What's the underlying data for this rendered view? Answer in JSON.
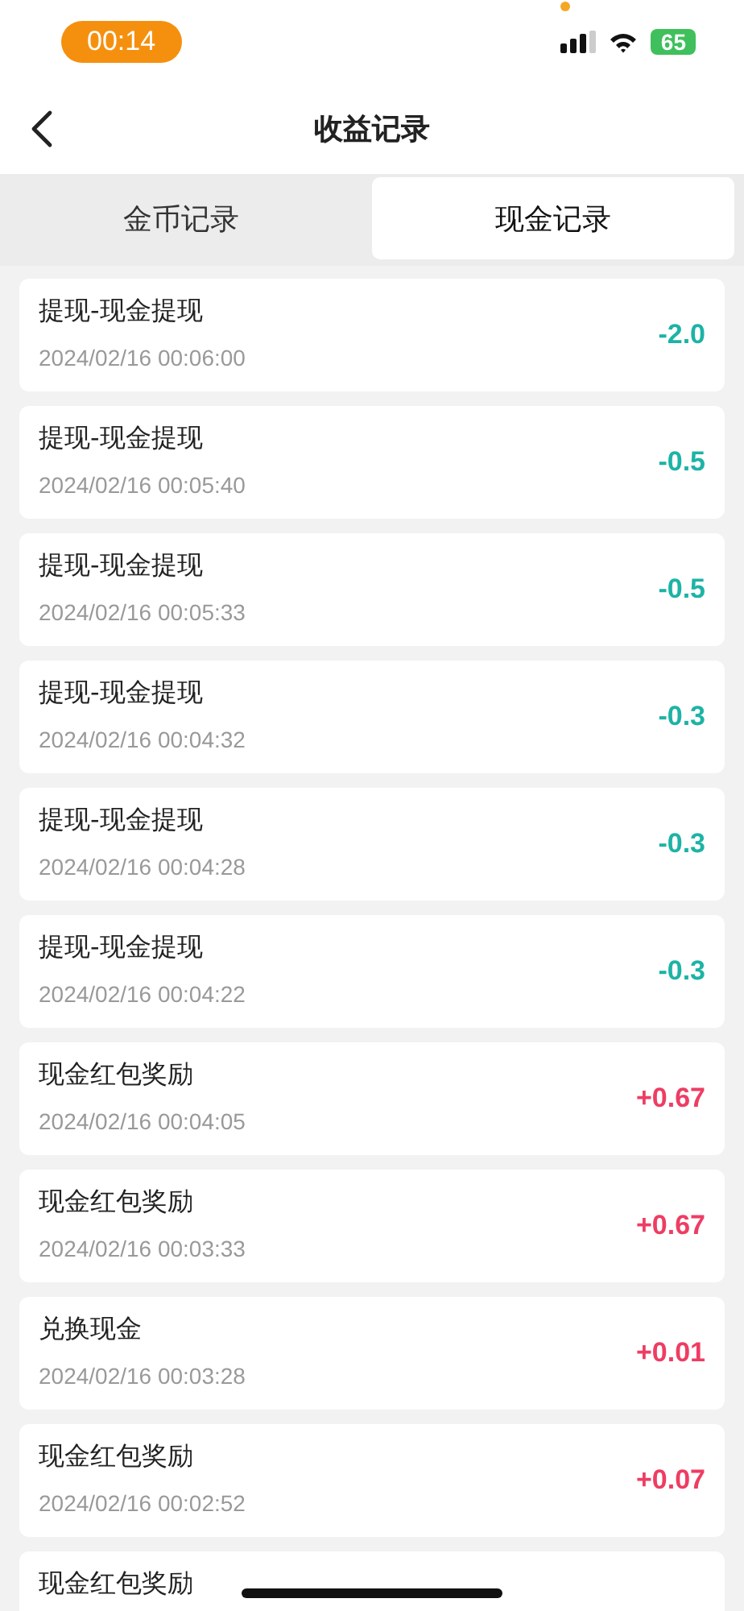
{
  "status_bar": {
    "time": "00:14",
    "battery": "65"
  },
  "nav_bar": {
    "title": "收益记录"
  },
  "tabs": [
    {
      "label": "金币记录",
      "selected": false
    },
    {
      "label": "现金记录",
      "selected": true
    }
  ],
  "records": [
    {
      "title": "提现-现金提现",
      "time": "2024/02/16 00:06:00",
      "amount": "-2.0",
      "kind": "expense"
    },
    {
      "title": "提现-现金提现",
      "time": "2024/02/16 00:05:40",
      "amount": "-0.5",
      "kind": "expense"
    },
    {
      "title": "提现-现金提现",
      "time": "2024/02/16 00:05:33",
      "amount": "-0.5",
      "kind": "expense"
    },
    {
      "title": "提现-现金提现",
      "time": "2024/02/16 00:04:32",
      "amount": "-0.3",
      "kind": "expense"
    },
    {
      "title": "提现-现金提现",
      "time": "2024/02/16 00:04:28",
      "amount": "-0.3",
      "kind": "expense"
    },
    {
      "title": "提现-现金提现",
      "time": "2024/02/16 00:04:22",
      "amount": "-0.3",
      "kind": "expense"
    },
    {
      "title": "现金红包奖励",
      "time": "2024/02/16 00:04:05",
      "amount": "+0.67",
      "kind": "income"
    },
    {
      "title": "现金红包奖励",
      "time": "2024/02/16 00:03:33",
      "amount": "+0.67",
      "kind": "income"
    },
    {
      "title": "兑换现金",
      "time": "2024/02/16 00:03:28",
      "amount": "+0.01",
      "kind": "income"
    },
    {
      "title": "现金红包奖励",
      "time": "2024/02/16 00:02:52",
      "amount": "+0.07",
      "kind": "income"
    },
    {
      "title": "现金红包奖励"
    }
  ]
}
